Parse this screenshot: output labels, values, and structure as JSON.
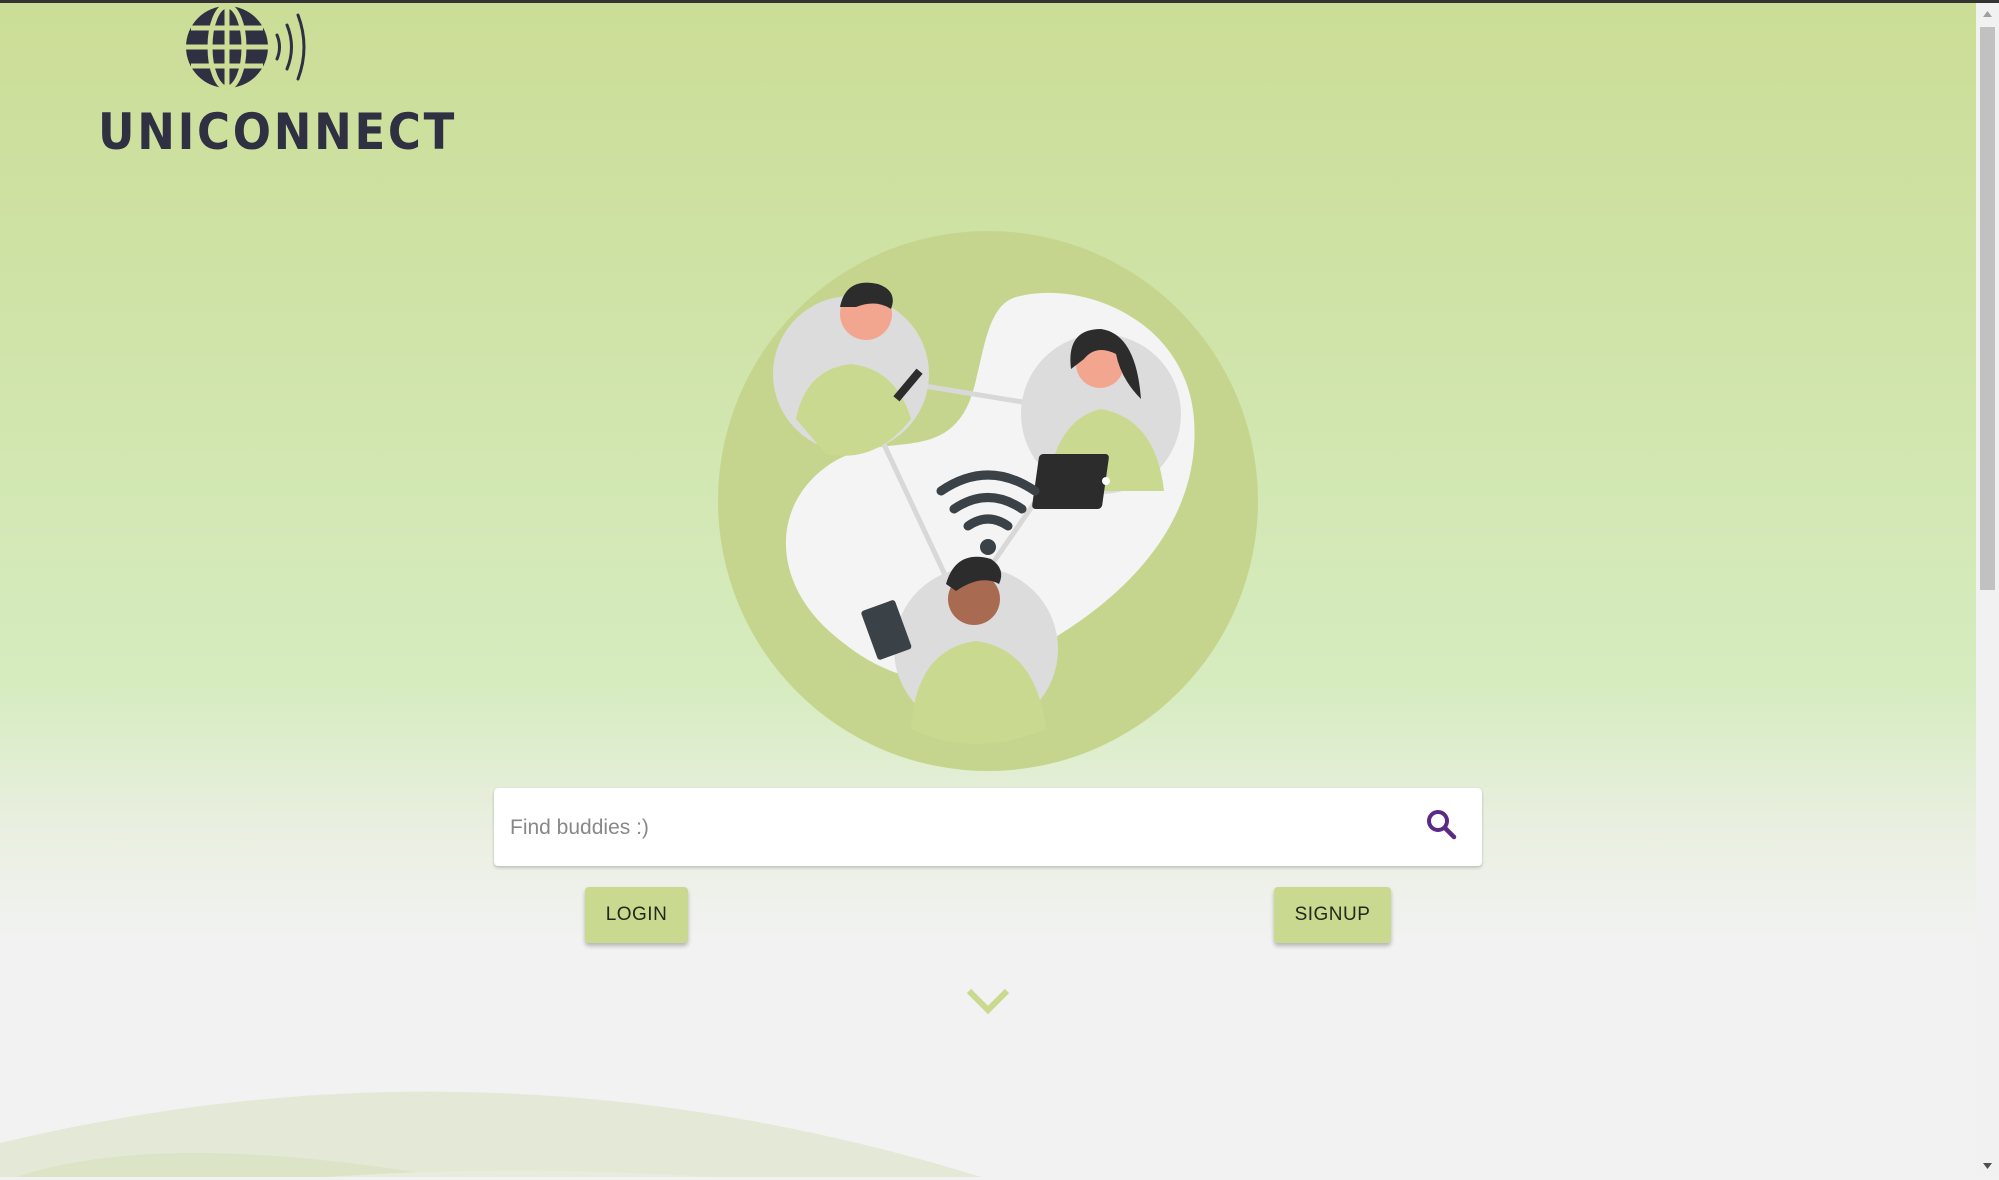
{
  "brand": {
    "name": "UNICONNECT"
  },
  "search": {
    "placeholder": "Find buddies :)"
  },
  "actions": {
    "login_label": "LOGIN",
    "signup_label": "SIGNUP"
  },
  "icons": {
    "logo": "globe-signal-icon",
    "search": "search-icon",
    "scroll": "chevron-down-icon"
  },
  "colors": {
    "accent": "#c9d98f",
    "brand_text": "#2f3042",
    "search_icon": "#5b2a86",
    "page_bottom": "#f2f2f2"
  }
}
